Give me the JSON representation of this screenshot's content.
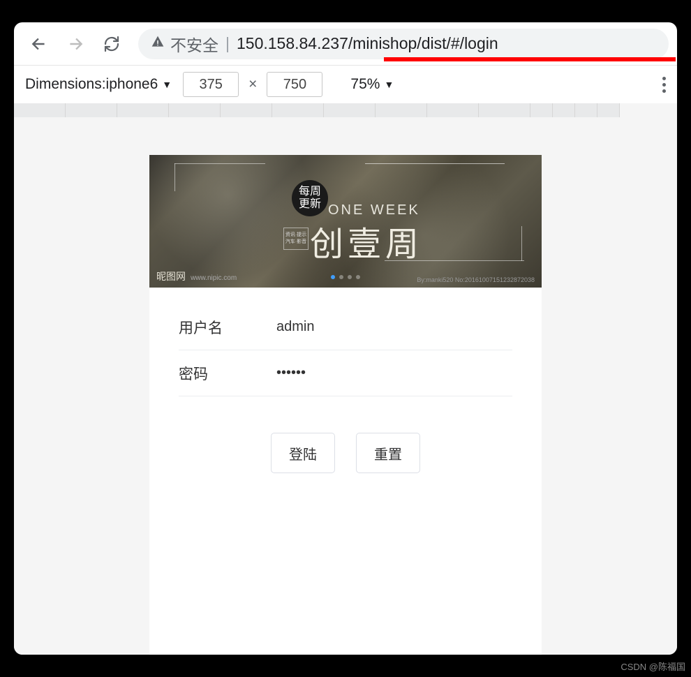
{
  "toolbar": {
    "security_label": "不安全",
    "url_host": "150.158.84.237",
    "url_path": "/minishop/dist/#/login"
  },
  "devtools": {
    "dimensions_label": "Dimensions: ",
    "device": "iphone6",
    "width": "375",
    "height": "750",
    "zoom": "75%"
  },
  "banner": {
    "circle_line1": "每周",
    "circle_line2": "更新",
    "subtitle": "ONE WEEK",
    "title": "创壹周",
    "tag_line1": "资讯·提示",
    "tag_line2": "汽车·影音",
    "logo_text": "昵图网",
    "logo_url": "www.nipic.com",
    "credit": "By:manki520 No:20161007151232872038"
  },
  "form": {
    "username_label": "用户名",
    "username_value": "admin",
    "password_label": "密码",
    "password_value": "••••••",
    "login_btn": "登陆",
    "reset_btn": "重置"
  },
  "watermark": "CSDN @陈福国"
}
